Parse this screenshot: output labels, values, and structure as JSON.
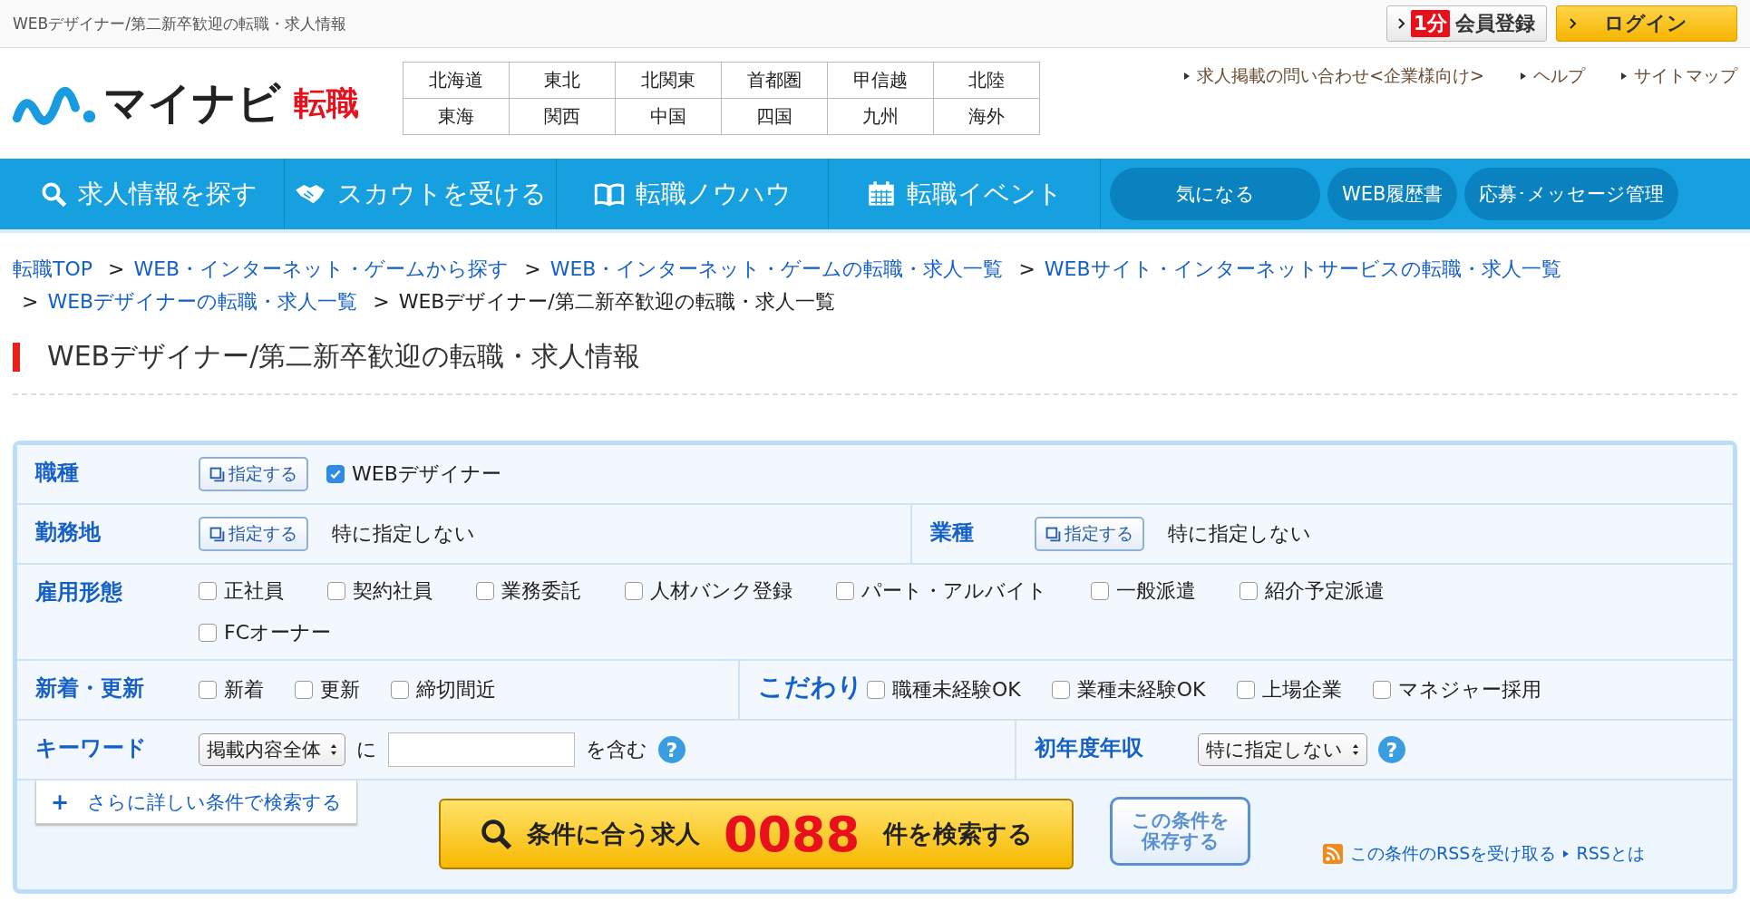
{
  "top_bar": {
    "page_title": "WEBデザイナー/第二新卒歓迎の転職・求人情報",
    "register_button": {
      "badge": "1分",
      "label": "会員登録"
    },
    "login_button": "ログイン"
  },
  "header": {
    "logo": {
      "name": "マイナビ",
      "sub": "転職"
    },
    "regions": [
      [
        "北海道",
        "東北",
        "北関東",
        "首都圏",
        "甲信越",
        "北陸"
      ],
      [
        "東海",
        "関西",
        "中国",
        "四国",
        "九州",
        "海外"
      ]
    ],
    "links": [
      "求人掲載の問い合わせ<企業様向け>",
      "ヘルプ",
      "サイトマップ"
    ]
  },
  "nav": {
    "items": [
      {
        "label": "求人情報を探す"
      },
      {
        "label": "スカウトを受ける"
      },
      {
        "label": "転職ノウハウ"
      },
      {
        "label": "転職イベント"
      }
    ],
    "pills": [
      "気になる",
      "WEB履歴書",
      "応募･メッセージ管理"
    ]
  },
  "breadcrumb": [
    {
      "text": "転職TOP",
      "kind": "link",
      "separator": ">"
    },
    {
      "text": "WEB・インターネット・ゲームから探す",
      "kind": "link",
      "separator": ">"
    },
    {
      "text": "WEB・インターネット・ゲームの転職・求人一覧",
      "kind": "link",
      "separator": ">"
    },
    {
      "text": "WEBサイト・インターネットサービスの転職・求人一覧",
      "kind": "link",
      "separator": ">"
    },
    {
      "text": "WEBデザイナーの転職・求人一覧",
      "kind": "link",
      "separator": ">"
    },
    {
      "text": "WEBデザイナー/第二新卒歓迎の転職・求人一覧",
      "kind": "current"
    }
  ],
  "page_heading": "WEBデザイナー/第二新卒歓迎の転職・求人情報",
  "search_form": {
    "job_type": {
      "label": "職種",
      "button": "指定する",
      "options": [
        {
          "label": "WEBデザイナー",
          "checked": true
        }
      ]
    },
    "location": {
      "label": "勤務地",
      "button": "指定する",
      "value": "特に指定しない"
    },
    "industry": {
      "label": "業種",
      "button": "指定する",
      "value": "特に指定しない"
    },
    "employment": {
      "label": "雇用形態",
      "options": [
        {
          "label": "正社員",
          "checked": false
        },
        {
          "label": "契約社員",
          "checked": false
        },
        {
          "label": "業務委託",
          "checked": false
        },
        {
          "label": "人材バンク登録",
          "checked": false
        },
        {
          "label": "パート・アルバイト",
          "checked": false
        },
        {
          "label": "一般派遣",
          "checked": false
        },
        {
          "label": "紹介予定派遣",
          "checked": false
        },
        {
          "label": "FCオーナー",
          "checked": false
        }
      ]
    },
    "newness": {
      "label": "新着・更新",
      "options": [
        {
          "label": "新着",
          "checked": false
        },
        {
          "label": "更新",
          "checked": false
        },
        {
          "label": "締切間近",
          "checked": false
        }
      ]
    },
    "preferences": {
      "label": "こだわり",
      "options": [
        {
          "label": "職種未経験OK",
          "checked": false
        },
        {
          "label": "業種未経験OK",
          "checked": false
        },
        {
          "label": "上場企業",
          "checked": false
        },
        {
          "label": "マネジャー採用",
          "checked": false
        }
      ]
    },
    "keyword": {
      "label": "キーワード",
      "scope": "掲載内容全体",
      "connector": "に",
      "suffix": "を含む",
      "help": "?"
    },
    "salary": {
      "label": "初年度年収",
      "value": "特に指定しない",
      "help": "?"
    },
    "more_button": {
      "mark": "+",
      "label": "さらに詳しい条件で検索する"
    },
    "search_button": {
      "prefix": "条件に合う求人",
      "count": "0088",
      "suffix": "件を検索する"
    },
    "save_button": [
      "この条件を",
      "保存する"
    ],
    "rss_link": "この条件のRSSを受け取る",
    "rss_about": "RSSとは"
  }
}
